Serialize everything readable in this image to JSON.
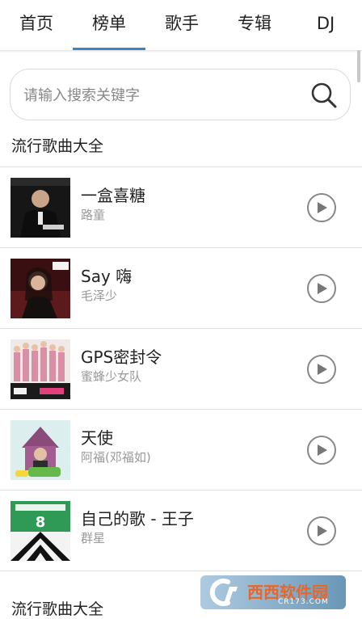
{
  "tabs": [
    {
      "label": "首页"
    },
    {
      "label": "榜单"
    },
    {
      "label": "歌手"
    },
    {
      "label": "专辑"
    },
    {
      "label": "DJ"
    }
  ],
  "active_tab": "榜单",
  "search": {
    "placeholder": "请输入搜索关键字",
    "value": ""
  },
  "section_titles": [
    "流行歌曲大全",
    "流行歌曲大全"
  ],
  "songs": [
    {
      "title": "一盒喜糖",
      "artist": "路童",
      "cover_color": "#1c1c1c"
    },
    {
      "title": "Say 嗨",
      "artist": "毛泽少",
      "cover_color": "#5a1a1a"
    },
    {
      "title": "GPS密封令",
      "artist": "蜜蜂少女队",
      "cover_color": "#e8e4e2"
    },
    {
      "title": "天使",
      "artist": "阿福(邓福如)",
      "cover_color": "#d8ecec"
    },
    {
      "title": "自己的歌 - 王子",
      "artist": "群星",
      "cover_color": "#2b8a4a"
    }
  ],
  "watermark": {
    "text": "西西软件园",
    "sub": "CR173.COM"
  },
  "colors": {
    "accent": "#3a84c7",
    "secondary_text": "#999999"
  }
}
